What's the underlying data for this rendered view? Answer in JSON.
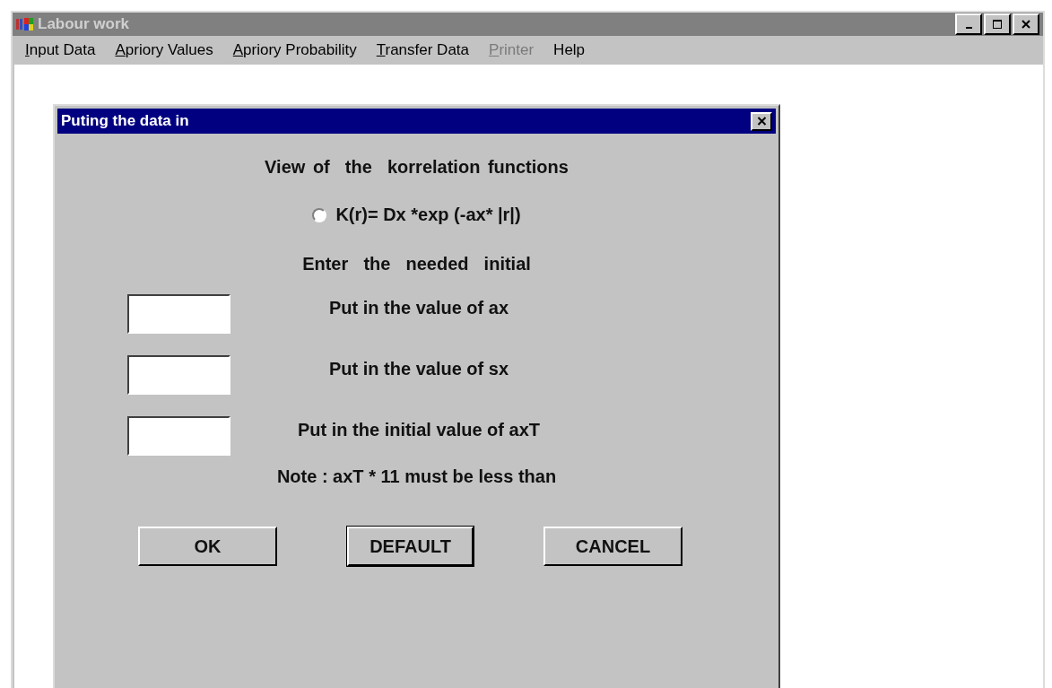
{
  "window": {
    "title": "Labour work"
  },
  "menu": [
    {
      "label": "Input Data",
      "disabled": false
    },
    {
      "label": "Apriory Values",
      "disabled": false
    },
    {
      "label": "Apriory Probability",
      "disabled": false
    },
    {
      "label": "Transfer Data",
      "disabled": false
    },
    {
      "label": "Printer",
      "disabled": true
    },
    {
      "label": "Help",
      "disabled": false
    }
  ],
  "dialog": {
    "title": "Puting the data in",
    "heading": "View of  the  korrelation functions",
    "radio": {
      "label": "K(r)= Dx *exp (-ax* |r|)",
      "selected": false
    },
    "subheading": "Enter  the  needed  initial",
    "fields": [
      {
        "label": "Put in the value of ax"
      },
      {
        "label": "Put in the value of sx"
      },
      {
        "label": "Put in the initial value of axT"
      }
    ],
    "note": "Note : axT * 11 must be less than",
    "buttons": [
      {
        "label": "OK",
        "default": false
      },
      {
        "label": "DEFAULT",
        "default": true
      },
      {
        "label": "CANCEL",
        "default": false
      }
    ]
  }
}
